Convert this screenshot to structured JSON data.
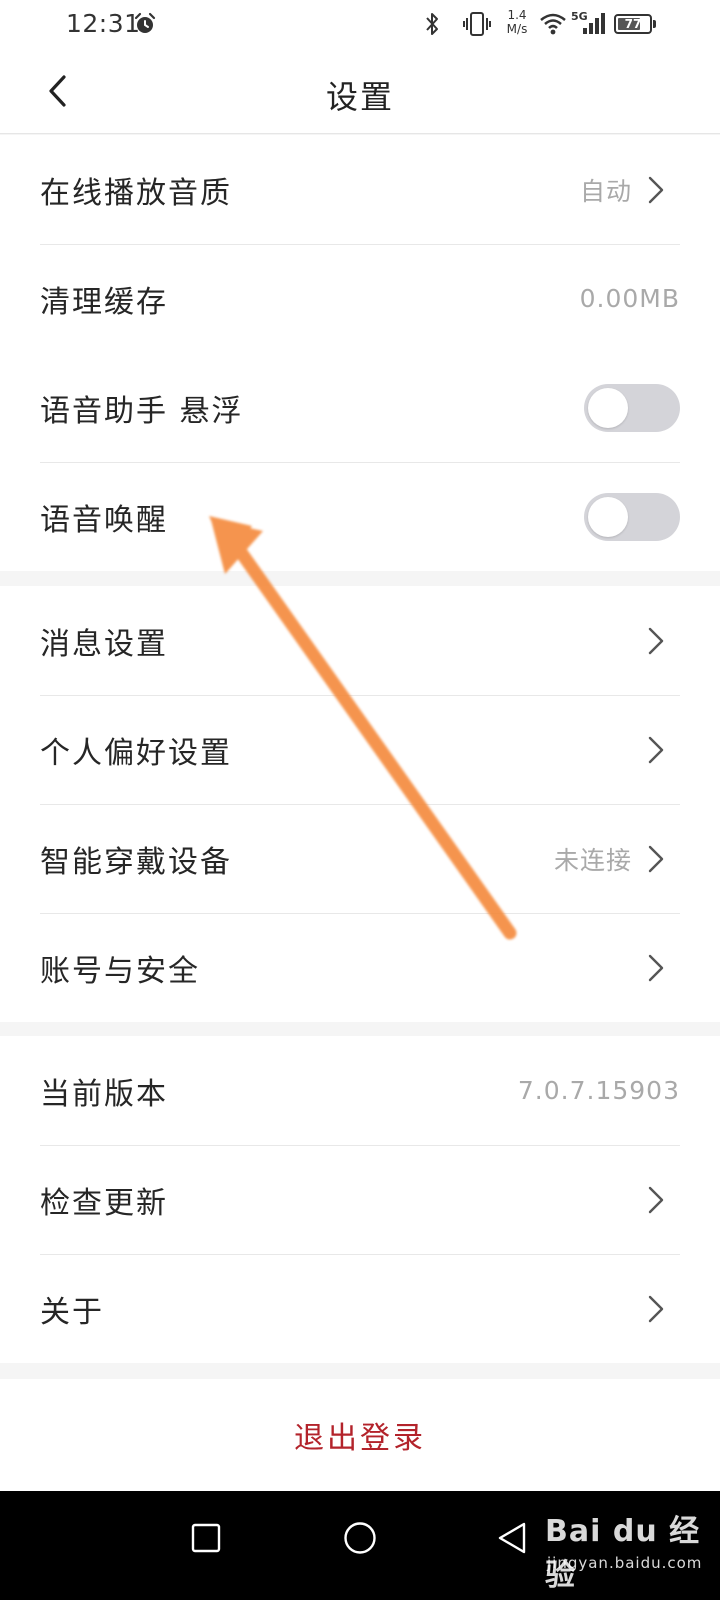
{
  "status_bar": {
    "time": "12:31",
    "net_speed_value": "1.4",
    "net_speed_unit": "M/s",
    "network_type": "5G",
    "battery": "77",
    "battery_level": 0.77,
    "icons": [
      "alarm-icon",
      "bluetooth-icon",
      "vibrate-icon",
      "wifi-icon",
      "cellular-signal-icon",
      "battery-icon"
    ]
  },
  "header": {
    "title": "设置",
    "back_icon": "chevron-left-icon"
  },
  "groups": [
    {
      "rows": [
        {
          "label": "在线播放音质",
          "value": "自动",
          "chevron": true
        },
        {
          "label": "清理缓存",
          "value": "0.00MB",
          "chevron": false
        }
      ]
    },
    {
      "rows": [
        {
          "label": "语音助手 悬浮",
          "toggle": false
        },
        {
          "label": "语音唤醒",
          "toggle": false
        }
      ]
    },
    {
      "rows": [
        {
          "label": "消息设置",
          "chevron": true
        },
        {
          "label": "个人偏好设置",
          "chevron": true
        },
        {
          "label": "智能穿戴设备",
          "value": "未连接",
          "chevron": true
        },
        {
          "label": "账号与安全",
          "chevron": true
        }
      ]
    },
    {
      "rows": [
        {
          "label": "当前版本",
          "value": "7.0.7.15903",
          "chevron": false
        },
        {
          "label": "检查更新",
          "chevron": true
        },
        {
          "label": "关于",
          "chevron": true
        }
      ]
    }
  ],
  "logout_label": "退出登录",
  "colors": {
    "logout": "#b3232b",
    "annotation_arrow": "#f4893a",
    "toggle_off": "#d4d4d9",
    "value_text": "#a9a9a9"
  },
  "nav_bar": {
    "buttons": [
      "recent-apps-square-icon",
      "home-circle-icon",
      "back-triangle-icon"
    ]
  },
  "watermark": {
    "main": "Bai du 经验",
    "sub": "jingyan.baidu.com"
  }
}
